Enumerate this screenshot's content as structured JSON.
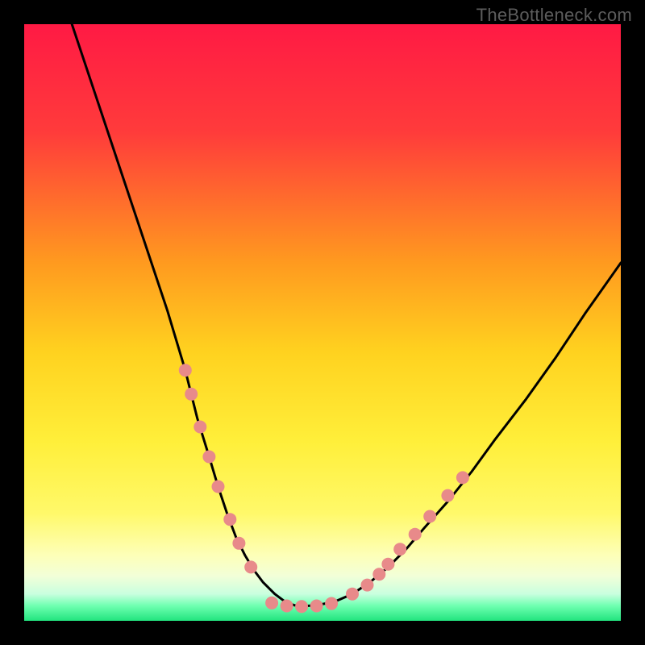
{
  "watermark": "TheBottleneck.com",
  "chart_data": {
    "type": "line",
    "title": "",
    "xlabel": "",
    "ylabel": "",
    "xlim": [
      0,
      100
    ],
    "ylim": [
      0,
      100
    ],
    "gradient_stops": [
      {
        "offset": 0.0,
        "color": "#ff1a44"
      },
      {
        "offset": 0.18,
        "color": "#ff3b3b"
      },
      {
        "offset": 0.4,
        "color": "#ff9a1f"
      },
      {
        "offset": 0.55,
        "color": "#ffd21f"
      },
      {
        "offset": 0.7,
        "color": "#ffef3a"
      },
      {
        "offset": 0.82,
        "color": "#fff96a"
      },
      {
        "offset": 0.89,
        "color": "#fdffb8"
      },
      {
        "offset": 0.925,
        "color": "#f2ffd8"
      },
      {
        "offset": 0.955,
        "color": "#c9ffdf"
      },
      {
        "offset": 0.975,
        "color": "#6effb0"
      },
      {
        "offset": 1.0,
        "color": "#22e47e"
      }
    ],
    "series": [
      {
        "name": "left-branch",
        "x": [
          8,
          12,
          16,
          20,
          24,
          27,
          29,
          31,
          32.5,
          34,
          35.5,
          37,
          38.5,
          40,
          42,
          44,
          46
        ],
        "y": [
          100,
          88,
          76,
          64,
          52,
          42,
          34,
          27.5,
          22.5,
          18,
          14,
          11,
          8.5,
          6.5,
          4.5,
          3,
          2.4
        ]
      },
      {
        "name": "right-branch",
        "x": [
          46,
          49,
          52,
          55,
          58,
          61,
          64,
          67,
          71,
          75,
          79,
          84,
          89,
          94,
          100
        ],
        "y": [
          2.4,
          2.6,
          3.2,
          4.5,
          6.5,
          9,
          12,
          15.5,
          20,
          25,
          30.5,
          37,
          44,
          51.5,
          60
        ]
      }
    ],
    "bead_points": {
      "left": [
        {
          "x": 27.0,
          "y": 42.0
        },
        {
          "x": 28.0,
          "y": 38.0
        },
        {
          "x": 29.5,
          "y": 32.5
        },
        {
          "x": 31.0,
          "y": 27.5
        },
        {
          "x": 32.5,
          "y": 22.5
        },
        {
          "x": 34.5,
          "y": 17.0
        },
        {
          "x": 36.0,
          "y": 13.0
        },
        {
          "x": 38.0,
          "y": 9.0
        }
      ],
      "right": [
        {
          "x": 55.0,
          "y": 4.5
        },
        {
          "x": 57.5,
          "y": 6.0
        },
        {
          "x": 59.5,
          "y": 7.8
        },
        {
          "x": 61.0,
          "y": 9.5
        },
        {
          "x": 63.0,
          "y": 12.0
        },
        {
          "x": 65.5,
          "y": 14.5
        },
        {
          "x": 68.0,
          "y": 17.5
        },
        {
          "x": 71.0,
          "y": 21.0
        },
        {
          "x": 73.5,
          "y": 24.0
        }
      ],
      "bottom": [
        {
          "x": 41.5,
          "y": 3.0
        },
        {
          "x": 44.0,
          "y": 2.5
        },
        {
          "x": 46.5,
          "y": 2.4
        },
        {
          "x": 49.0,
          "y": 2.5
        },
        {
          "x": 51.5,
          "y": 2.9
        }
      ]
    },
    "bead_color": "#e88a8a",
    "bead_radius": 8
  }
}
